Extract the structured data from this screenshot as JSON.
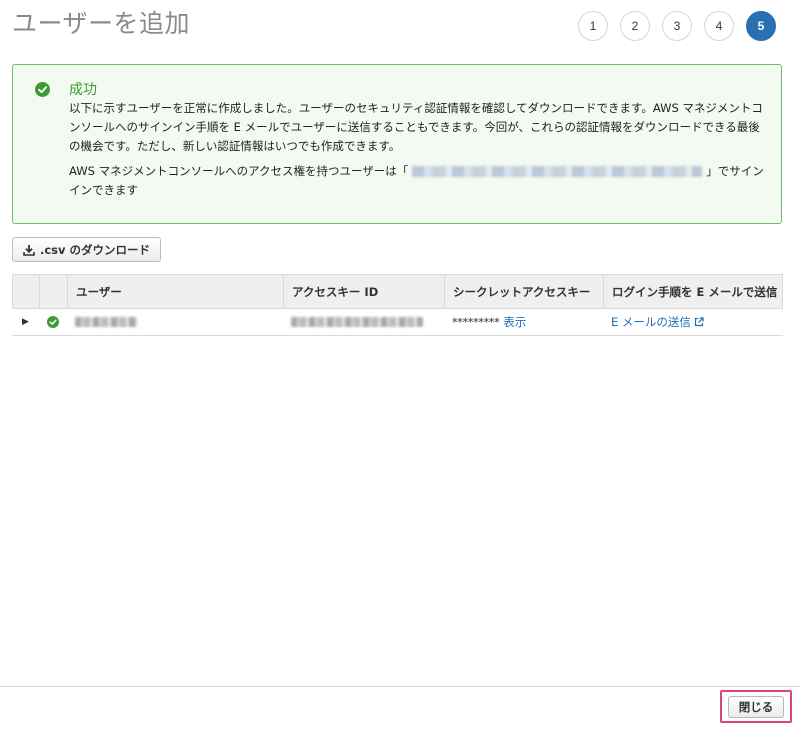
{
  "page": {
    "title": "ユーザーを追加"
  },
  "steps": [
    "1",
    "2",
    "3",
    "4",
    "5"
  ],
  "active_step": "5",
  "alert": {
    "title": "成功",
    "message": "以下に示すユーザーを正常に作成しました。ユーザーのセキュリティ認証情報を確認してダウンロードできます。AWS マネジメントコンソールへのサインイン手順を E メールでユーザーに送信することもできます。今回が、これらの認証情報をダウンロードできる最後の機会です。ただし、新しい認証情報はいつでも作成できます。",
    "console_prefix": "AWS マネジメントコンソールへのアクセス権を持つユーザーは「",
    "console_suffix": "」でサインインできます"
  },
  "toolbar": {
    "download_csv_label": ".csv のダウンロード"
  },
  "table": {
    "headers": [
      "",
      "",
      "ユーザー",
      "アクセスキー ID",
      "シークレットアクセスキー",
      "ログイン手順を E メールで送信"
    ],
    "rows": [
      {
        "secret_masked": "*********",
        "show_link": "表示",
        "email_link": "E メールの送信"
      }
    ]
  },
  "footer": {
    "close_label": "閉じる"
  },
  "colors": {
    "accent": "#2a6fb2",
    "success": "#3d9b35",
    "link": "#1d6fb8",
    "highlight": "#e0457a"
  }
}
